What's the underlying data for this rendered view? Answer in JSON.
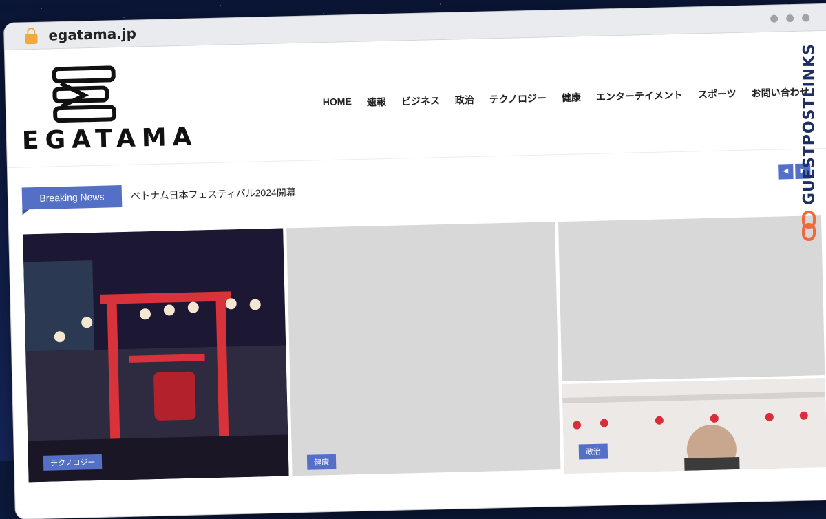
{
  "browser": {
    "url": "egatama.jp",
    "lock_icon": "lock-icon"
  },
  "site": {
    "logo_text": "EGATAMA",
    "nav": [
      "HOME",
      "速報",
      "ビジネス",
      "政治",
      "テクノロジー",
      "健康",
      "エンターテイメント",
      "スポーツ",
      "お問い合わせ"
    ]
  },
  "breaking": {
    "label": "Breaking News",
    "headline": "ベトナム日本フェスティバル2024開幕",
    "prev_icon": "chevron-left-icon",
    "next_icon": "chevron-right-icon"
  },
  "tiles": [
    {
      "category": "テクノロジー"
    },
    {
      "category": "健康"
    },
    {
      "category": ""
    },
    {
      "category": "政治"
    }
  ],
  "watermark": {
    "text": "GUESTPOSTLINKS"
  },
  "colors": {
    "accent": "#5470c6",
    "space": "#0d1a3c",
    "chrome": "#e9ebee"
  }
}
